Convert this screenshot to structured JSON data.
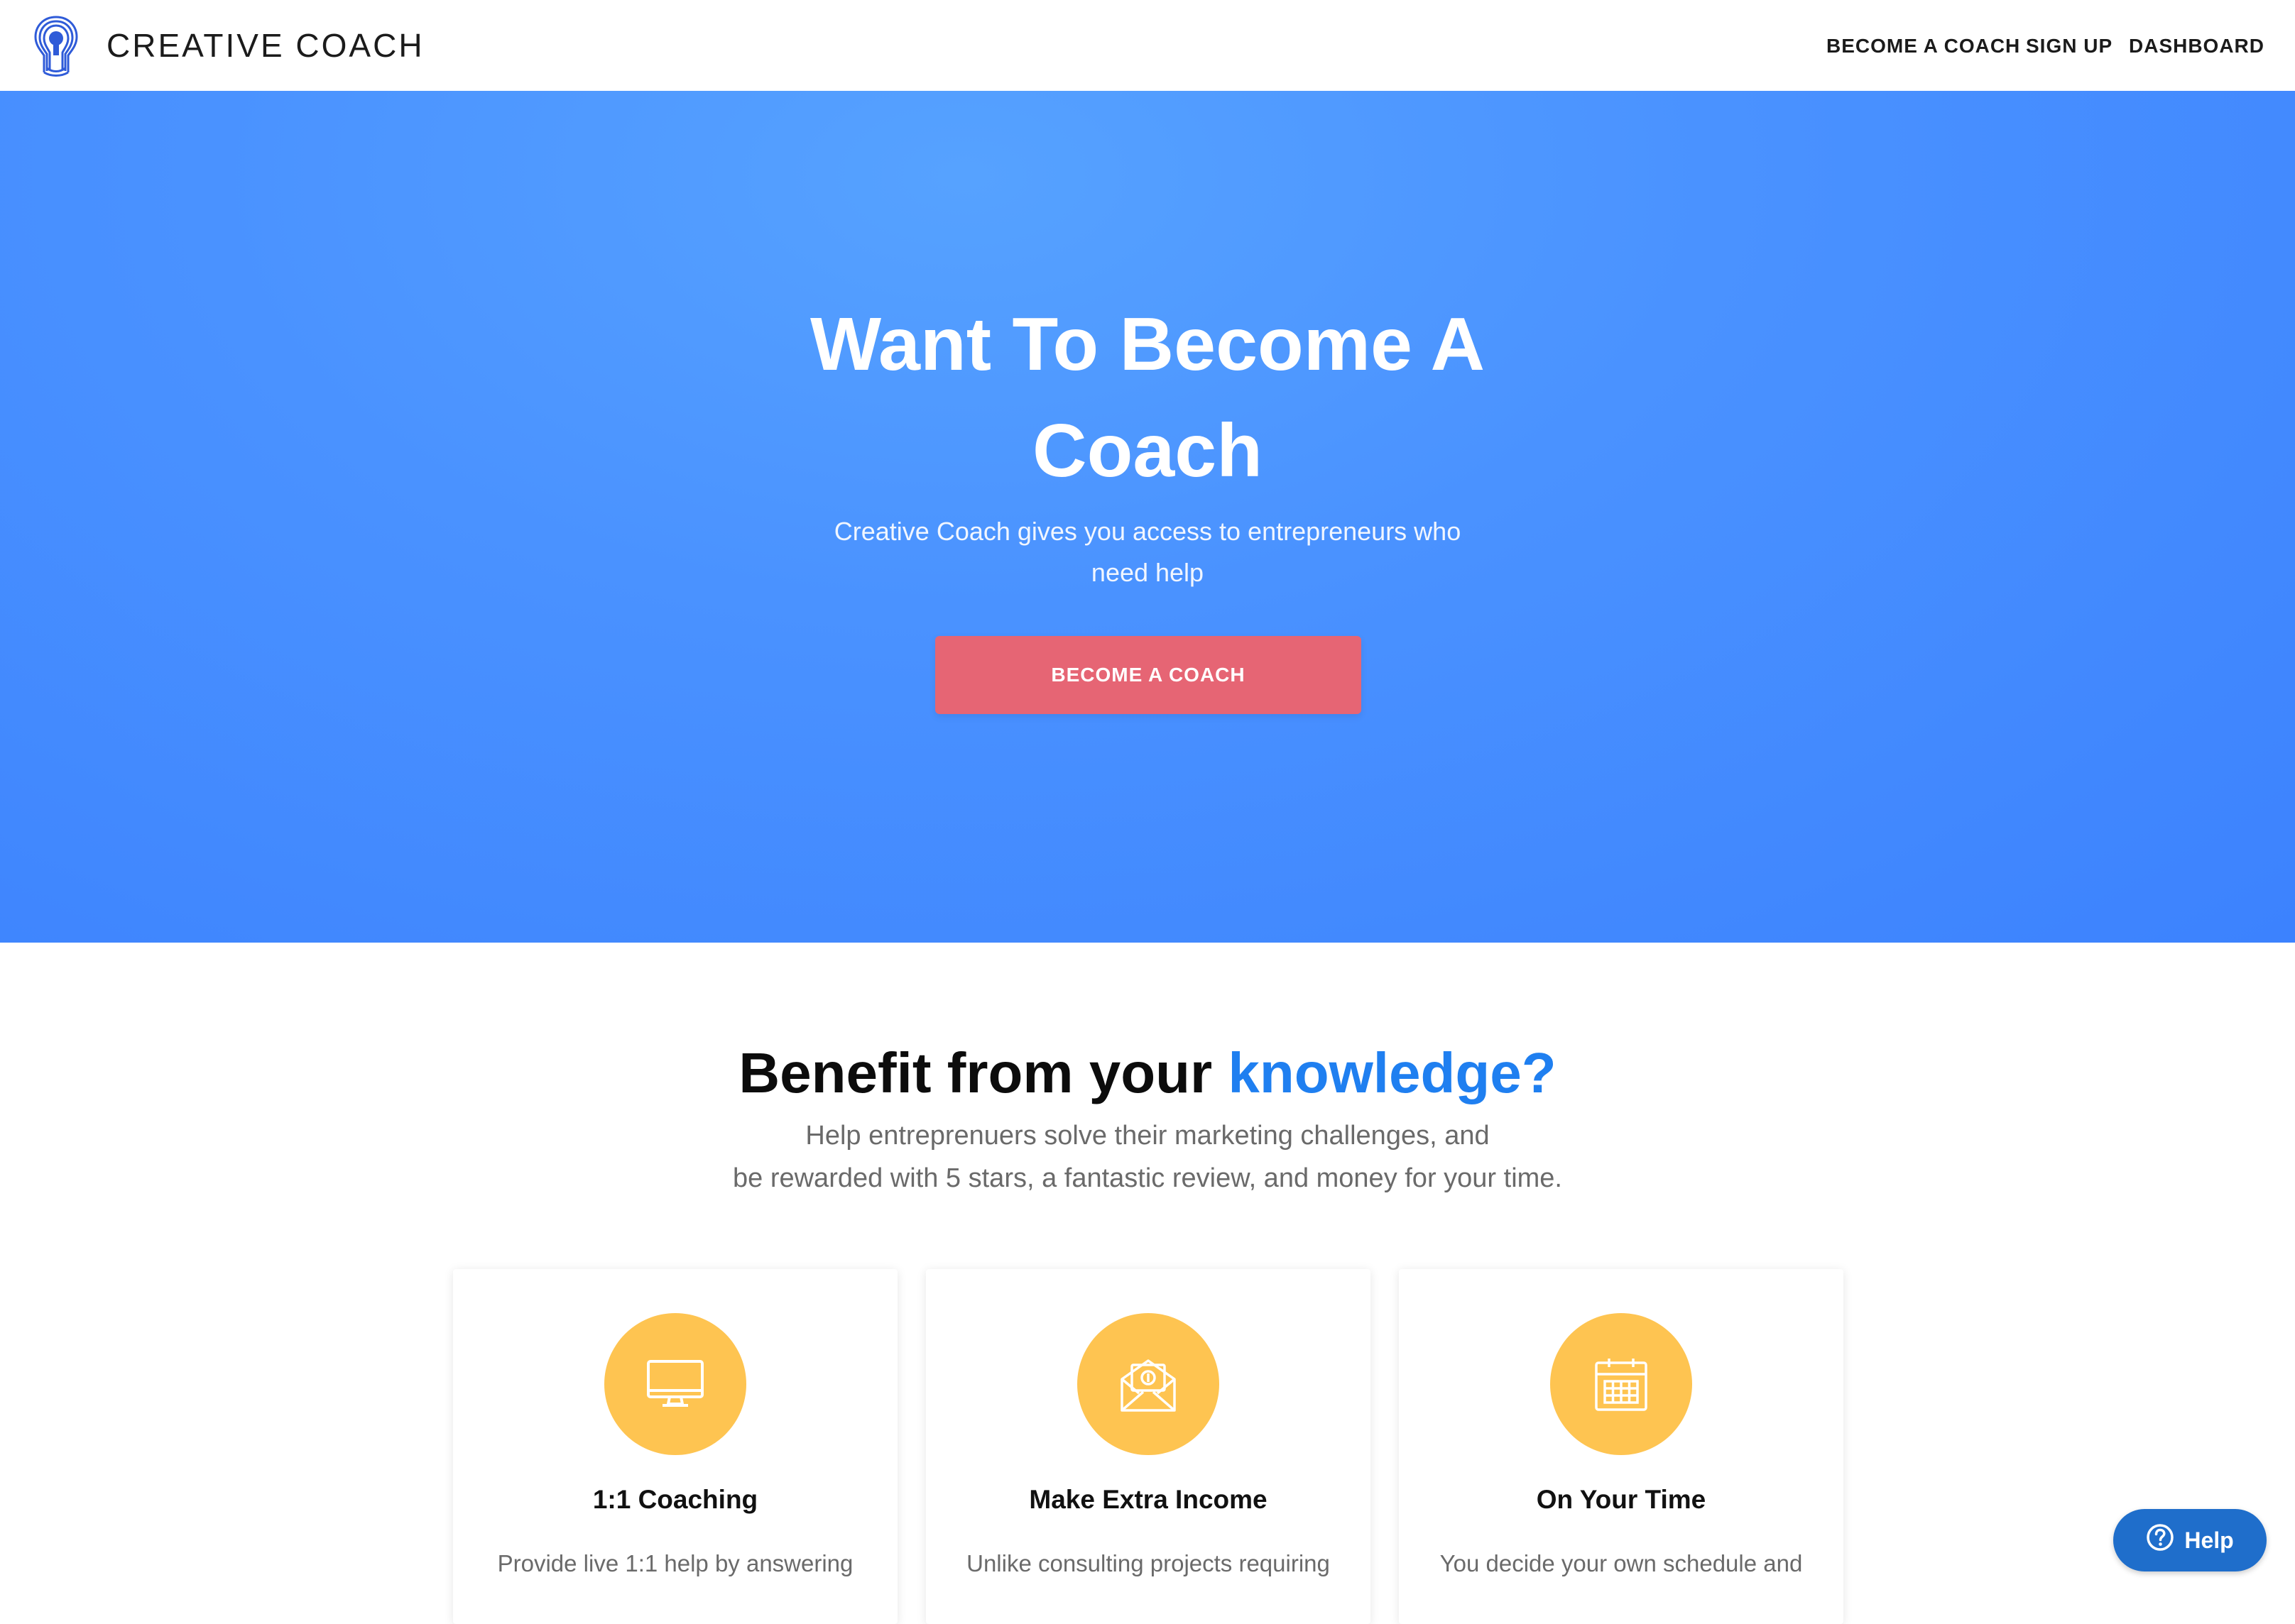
{
  "header": {
    "brand": "CREATIVE COACH",
    "nav": {
      "become_coach": "BECOME A COACH",
      "sign_up": "SIGN UP",
      "dashboard": "DASHBOARD"
    }
  },
  "hero": {
    "title": "Want To Become A Coach",
    "subtitle": "Creative Coach gives you access to entrepreneurs who need help",
    "cta": "BECOME A COACH"
  },
  "benefits": {
    "title_prefix": "Benefit from your ",
    "title_accent": "knowledge?",
    "subtitle_line1": "Help entreprenuers solve their marketing challenges, and",
    "subtitle_line2": "be rewarded with 5 stars, a fantastic review, and money for your time.",
    "cards": [
      {
        "title": "1:1 Coaching",
        "text": "Provide live 1:1 help by answering",
        "icon": "monitor-icon"
      },
      {
        "title": "Make Extra Income",
        "text": "Unlike consulting projects requiring",
        "icon": "money-envelope-icon"
      },
      {
        "title": "On Your Time",
        "text": "You decide your own schedule and",
        "icon": "calendar-icon"
      }
    ]
  },
  "help_widget": {
    "label": "Help",
    "icon": "question-circle-icon"
  },
  "colors": {
    "hero_blue": "#4a92ff",
    "cta_red": "#e66574",
    "accent_blue": "#1f7ff0",
    "icon_yellow": "#fec451",
    "help_blue": "#1f6ecb"
  }
}
